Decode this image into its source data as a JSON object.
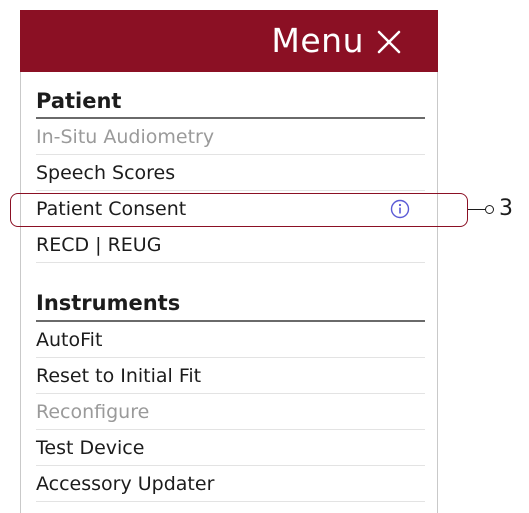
{
  "menu": {
    "title": "Menu",
    "close_icon": "close-icon"
  },
  "sections": {
    "patient": {
      "title": "Patient",
      "items": [
        {
          "label": "In-Situ Audiometry",
          "disabled": true
        },
        {
          "label": "Speech Scores",
          "disabled": false
        },
        {
          "label": "Patient Consent",
          "disabled": false,
          "icon": "info-icon"
        },
        {
          "label": "RECD | REUG",
          "disabled": false
        }
      ]
    },
    "instruments": {
      "title": "Instruments",
      "items": [
        {
          "label": "AutoFit",
          "disabled": false
        },
        {
          "label": "Reset to Initial Fit",
          "disabled": false
        },
        {
          "label": "Reconfigure",
          "disabled": true
        },
        {
          "label": "Test Device",
          "disabled": false
        },
        {
          "label": "Accessory Updater",
          "disabled": false
        }
      ]
    }
  },
  "callout": {
    "number": "3"
  },
  "colors": {
    "header_bg": "#8b1024",
    "header_text": "#ffffff",
    "disabled_text": "#9a9a9a",
    "info_icon": "#5b5bd6"
  }
}
